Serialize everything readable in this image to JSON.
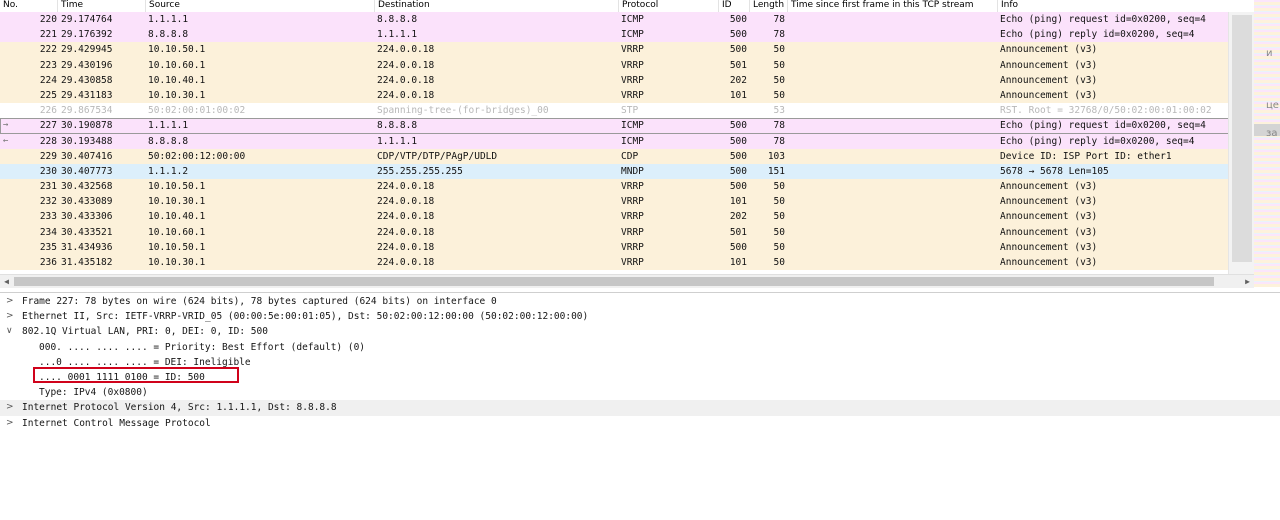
{
  "columns": {
    "no": "No.",
    "time": "Time",
    "source": "Source",
    "destination": "Destination",
    "protocol": "Protocol",
    "id": "ID",
    "length": "Length",
    "tcp_time": "Time since first frame in this TCP stream",
    "info": "Info"
  },
  "packets": [
    {
      "no": "220",
      "time": "29.174764",
      "source": "1.1.1.1",
      "destination": "8.8.8.8",
      "protocol": "ICMP",
      "id": "500",
      "length": "78",
      "tcp_time": "",
      "info": "Echo (ping) request  id=0x0200, seq=4",
      "type": "icmp"
    },
    {
      "no": "221",
      "time": "29.176392",
      "source": "8.8.8.8",
      "destination": "1.1.1.1",
      "protocol": "ICMP",
      "id": "500",
      "length": "78",
      "tcp_time": "",
      "info": "Echo (ping) reply    id=0x0200, seq=4",
      "type": "icmp"
    },
    {
      "no": "222",
      "time": "29.429945",
      "source": "10.10.50.1",
      "destination": "224.0.0.18",
      "protocol": "VRRP",
      "id": "500",
      "length": "50",
      "tcp_time": "",
      "info": "Announcement (v3)",
      "type": "vrrp"
    },
    {
      "no": "223",
      "time": "29.430196",
      "source": "10.10.60.1",
      "destination": "224.0.0.18",
      "protocol": "VRRP",
      "id": "501",
      "length": "50",
      "tcp_time": "",
      "info": "Announcement (v3)",
      "type": "vrrp"
    },
    {
      "no": "224",
      "time": "29.430858",
      "source": "10.10.40.1",
      "destination": "224.0.0.18",
      "protocol": "VRRP",
      "id": "202",
      "length": "50",
      "tcp_time": "",
      "info": "Announcement (v3)",
      "type": "vrrp"
    },
    {
      "no": "225",
      "time": "29.431183",
      "source": "10.10.30.1",
      "destination": "224.0.0.18",
      "protocol": "VRRP",
      "id": "101",
      "length": "50",
      "tcp_time": "",
      "info": "Announcement (v3)",
      "type": "vrrp"
    },
    {
      "no": "226",
      "time": "29.867534",
      "source": "50:02:00:01:00:02",
      "destination": "Spanning-tree-(for-bridges)_00",
      "protocol": "STP",
      "id": "",
      "length": "53",
      "tcp_time": "",
      "info": "RST. Root = 32768/0/50:02:00:01:00:02",
      "type": "stp"
    },
    {
      "no": "227",
      "time": "30.190878",
      "source": "1.1.1.1",
      "destination": "8.8.8.8",
      "protocol": "ICMP",
      "id": "500",
      "length": "78",
      "tcp_time": "",
      "info": "Echo (ping) request  id=0x0200, seq=4",
      "type": "icmp",
      "selected": true,
      "mark": "→"
    },
    {
      "no": "228",
      "time": "30.193488",
      "source": "8.8.8.8",
      "destination": "1.1.1.1",
      "protocol": "ICMP",
      "id": "500",
      "length": "78",
      "tcp_time": "",
      "info": "Echo (ping) reply    id=0x0200, seq=4",
      "type": "icmp",
      "mark": "←"
    },
    {
      "no": "229",
      "time": "30.407416",
      "source": "50:02:00:12:00:00",
      "destination": "CDP/VTP/DTP/PAgP/UDLD",
      "protocol": "CDP",
      "id": "500",
      "length": "103",
      "tcp_time": "",
      "info": "Device ID: ISP  Port ID: ether1",
      "type": "cdp"
    },
    {
      "no": "230",
      "time": "30.407773",
      "source": "1.1.1.2",
      "destination": "255.255.255.255",
      "protocol": "MNDP",
      "id": "500",
      "length": "151",
      "tcp_time": "",
      "info": "5678 → 5678 Len=105",
      "type": "mndp"
    },
    {
      "no": "231",
      "time": "30.432568",
      "source": "10.10.50.1",
      "destination": "224.0.0.18",
      "protocol": "VRRP",
      "id": "500",
      "length": "50",
      "tcp_time": "",
      "info": "Announcement (v3)",
      "type": "vrrp"
    },
    {
      "no": "232",
      "time": "30.433089",
      "source": "10.10.30.1",
      "destination": "224.0.0.18",
      "protocol": "VRRP",
      "id": "101",
      "length": "50",
      "tcp_time": "",
      "info": "Announcement (v3)",
      "type": "vrrp"
    },
    {
      "no": "233",
      "time": "30.433306",
      "source": "10.10.40.1",
      "destination": "224.0.0.18",
      "protocol": "VRRP",
      "id": "202",
      "length": "50",
      "tcp_time": "",
      "info": "Announcement (v3)",
      "type": "vrrp"
    },
    {
      "no": "234",
      "time": "30.433521",
      "source": "10.10.60.1",
      "destination": "224.0.0.18",
      "protocol": "VRRP",
      "id": "501",
      "length": "50",
      "tcp_time": "",
      "info": "Announcement (v3)",
      "type": "vrrp"
    },
    {
      "no": "235",
      "time": "31.434936",
      "source": "10.10.50.1",
      "destination": "224.0.0.18",
      "protocol": "VRRP",
      "id": "500",
      "length": "50",
      "tcp_time": "",
      "info": "Announcement (v3)",
      "type": "vrrp"
    },
    {
      "no": "236",
      "time": "31.435182",
      "source": "10.10.30.1",
      "destination": "224.0.0.18",
      "protocol": "VRRP",
      "id": "101",
      "length": "50",
      "tcp_time": "",
      "info": "Announcement (v3)",
      "type": "vrrp"
    }
  ],
  "details": [
    {
      "level": 0,
      "caret": ">",
      "text": "Frame 227: 78 bytes on wire (624 bits), 78 bytes captured (624 bits) on interface 0"
    },
    {
      "level": 0,
      "caret": ">",
      "text": "Ethernet II, Src: IETF-VRRP-VRID_05 (00:00:5e:00:01:05), Dst: 50:02:00:12:00:00 (50:02:00:12:00:00)"
    },
    {
      "level": 0,
      "caret": "∨",
      "text": "802.1Q Virtual LAN, PRI: 0, DEI: 0, ID: 500"
    },
    {
      "level": 1,
      "caret": "",
      "text": "000. .... .... .... = Priority: Best Effort (default) (0)"
    },
    {
      "level": 1,
      "caret": "",
      "text": "...0 .... .... .... = DEI: Ineligible"
    },
    {
      "level": 1,
      "caret": "",
      "text": ".... 0001 1111 0100 = ID: 500",
      "highlight": true
    },
    {
      "level": 1,
      "caret": "",
      "text": "Type: IPv4 (0x0800)"
    },
    {
      "level": 0,
      "caret": ">",
      "text": "Internet Protocol Version 4, Src: 1.1.1.1, Dst: 8.8.8.8",
      "selected": true
    },
    {
      "level": 0,
      "caret": ">",
      "text": "Internet Control Message Protocol"
    }
  ],
  "scroll": {
    "left_arrow": "◀",
    "right_arrow": "▶"
  },
  "edge_fragments": [
    "и",
    "це",
    "за"
  ],
  "colors": {
    "icmp": "#fbe2fb",
    "vrrp": "#fcf1da",
    "mndp": "#dceffb",
    "highlight_box": "#d0021b"
  }
}
